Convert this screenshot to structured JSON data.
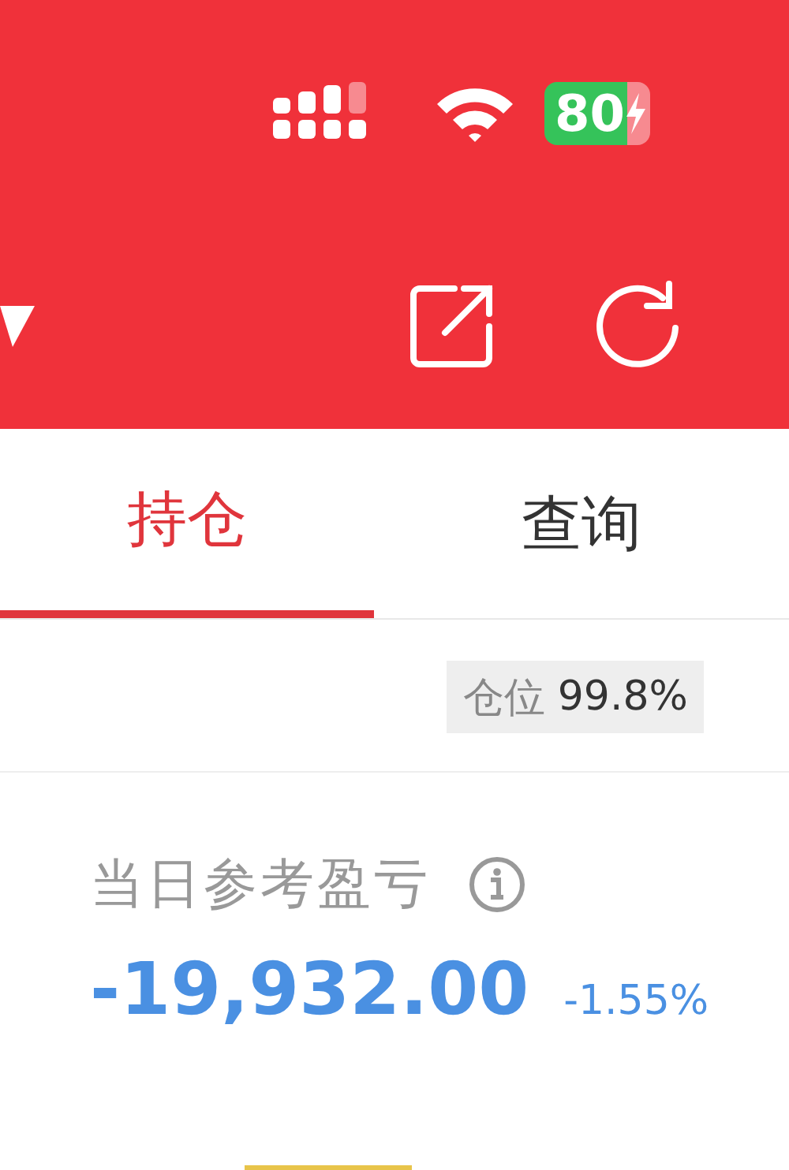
{
  "status_bar": {
    "battery": "80"
  },
  "tabs": [
    {
      "label": "持仓",
      "selected": true
    },
    {
      "label": "查询",
      "selected": false
    }
  ],
  "position": {
    "label": "仓位",
    "value": "99.8%"
  },
  "daily_pnl": {
    "label": "当日参考盈亏",
    "value": "-19,932.00",
    "percent": "-1.55%"
  }
}
